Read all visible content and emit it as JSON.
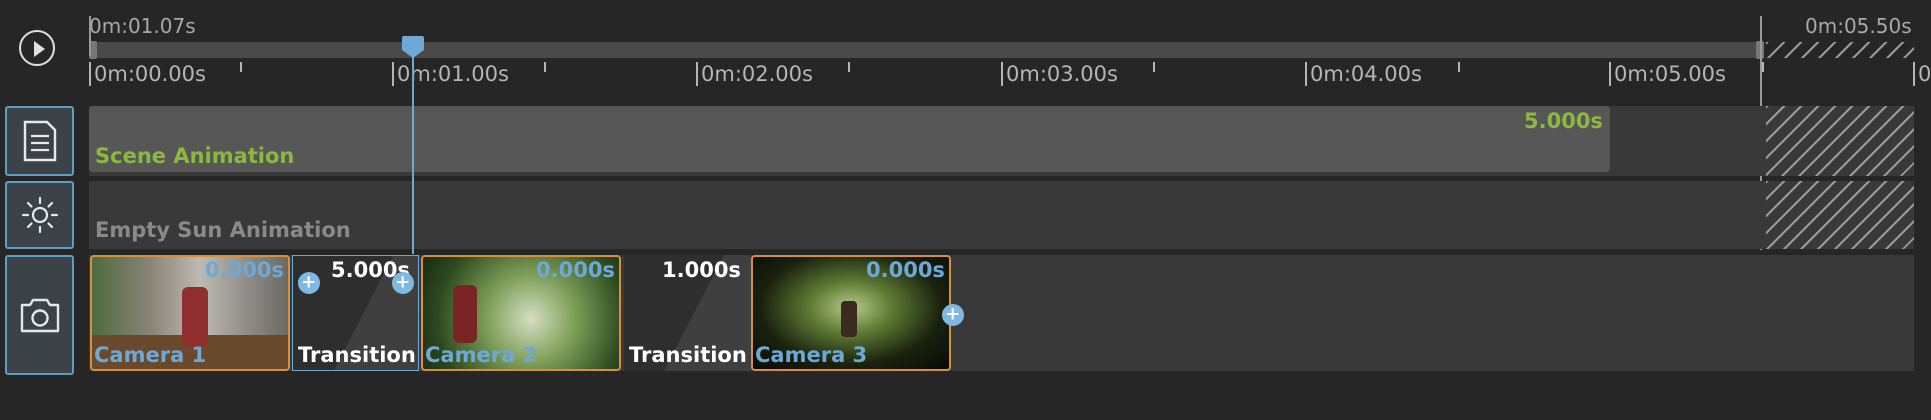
{
  "transport": {
    "play_icon": "play-icon"
  },
  "sidebar": {
    "buttons": [
      {
        "id": "scene",
        "icon": "document-icon"
      },
      {
        "id": "sun",
        "icon": "sun-icon"
      },
      {
        "id": "camera",
        "icon": "camera-icon"
      }
    ]
  },
  "ruler": {
    "current_time": "0m:01.07s",
    "end_time": "0m:05.50s",
    "ticks": [
      "0m:00.00s",
      "0m:01.00s",
      "0m:02.00s",
      "0m:03.00s",
      "0m:04.00s",
      "0m:05.00s",
      "0"
    ]
  },
  "tracks": {
    "scene": {
      "label": "Scene Animation",
      "duration": "5.000s"
    },
    "sun": {
      "label": "Empty Sun Animation"
    },
    "camera": {
      "clips": [
        {
          "type": "camera",
          "name": "Camera 1",
          "duration": "0.000s"
        },
        {
          "type": "transition",
          "name": "Transition",
          "duration": "5.000s"
        },
        {
          "type": "camera",
          "name": "Camera 2",
          "duration": "0.000s"
        },
        {
          "type": "transition",
          "name": "Transition",
          "duration": "1.000s"
        },
        {
          "type": "camera",
          "name": "Camera 3",
          "duration": "0.000s"
        }
      ]
    }
  },
  "colors": {
    "accent_blue": "#6ea8d6",
    "scene_green": "#8db83f",
    "camera_border": "#d7913b",
    "muted_text": "#8a8a8a"
  }
}
